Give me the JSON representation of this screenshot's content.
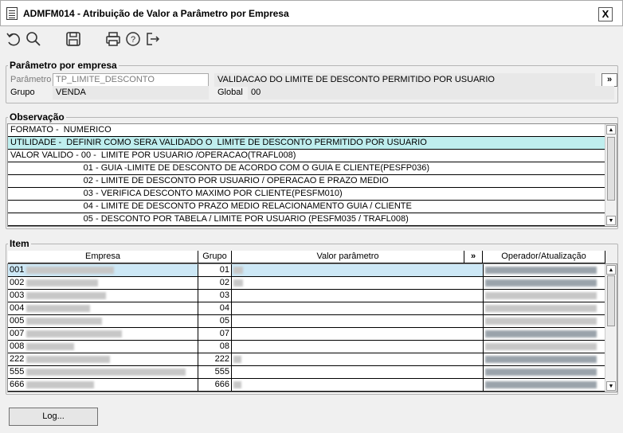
{
  "window": {
    "title": "ADMFM014 - Atribuição de Valor a Parâmetro por Empresa",
    "close_label": "X"
  },
  "toolbar": {
    "icons": [
      "undo-icon",
      "search-icon",
      "save-icon",
      "print-icon",
      "help-icon",
      "exit-icon"
    ]
  },
  "param": {
    "legend": "Parâmetro por empresa",
    "param_label": "Parâmetro",
    "param_value": "TP_LIMITE_DESCONTO",
    "param_desc": "VALIDACAO DO  LIMITE DE DESCONTO PERMITIDO POR USUARIO",
    "expand_label": "»",
    "group_label": "Grupo",
    "group_value": "VENDA",
    "global_label": "Global",
    "global_value": "00"
  },
  "obs": {
    "legend": "Observação",
    "lines": [
      "FORMATO -  NUMERICO",
      "UTILIDADE -  DEFINIR COMO SERA VALIDADO O  LIMITE DE DESCONTO PERMITIDO POR USUARIO",
      "VALOR VALIDO - 00 -  LIMITE POR USUARIO /OPERACAO(TRAFL008)",
      "                              01 - GUIA -LIMITE DE DESCONTO DE ACORDO COM O GUIA E CLIENTE(PESFP036)",
      "                              02 - LIMITE DE DESCONTO POR USUARIO / OPERACAO E PRAZO MEDIO",
      "                              03 - VERIFICA DESCONTO MAXIMO POR CLIENTE(PESFM010)",
      "                              04 - LIMITE DE DESCONTO PRAZO MEDIO RELACIONAMENTO GUIA / CLIENTE",
      "                              05 - DESCONTO POR TABELA / LIMITE POR USUARIO (PESFM035 / TRAFL008)"
    ]
  },
  "items": {
    "legend": "Item",
    "headers": {
      "empresa": "Empresa",
      "grupo": "Grupo",
      "valor": "Valor parâmetro",
      "expand": "»",
      "operador": "Operador/Atualização"
    },
    "rows": [
      {
        "code": "001",
        "grupo": "01"
      },
      {
        "code": "002",
        "grupo": "02"
      },
      {
        "code": "003",
        "grupo": "03"
      },
      {
        "code": "004",
        "grupo": "04"
      },
      {
        "code": "005",
        "grupo": "05"
      },
      {
        "code": "007",
        "grupo": "07"
      },
      {
        "code": "008",
        "grupo": "08"
      },
      {
        "code": "222",
        "grupo": "222"
      },
      {
        "code": "555",
        "grupo": "555"
      },
      {
        "code": "666",
        "grupo": "666"
      }
    ]
  },
  "footer": {
    "log_label": "Log..."
  }
}
